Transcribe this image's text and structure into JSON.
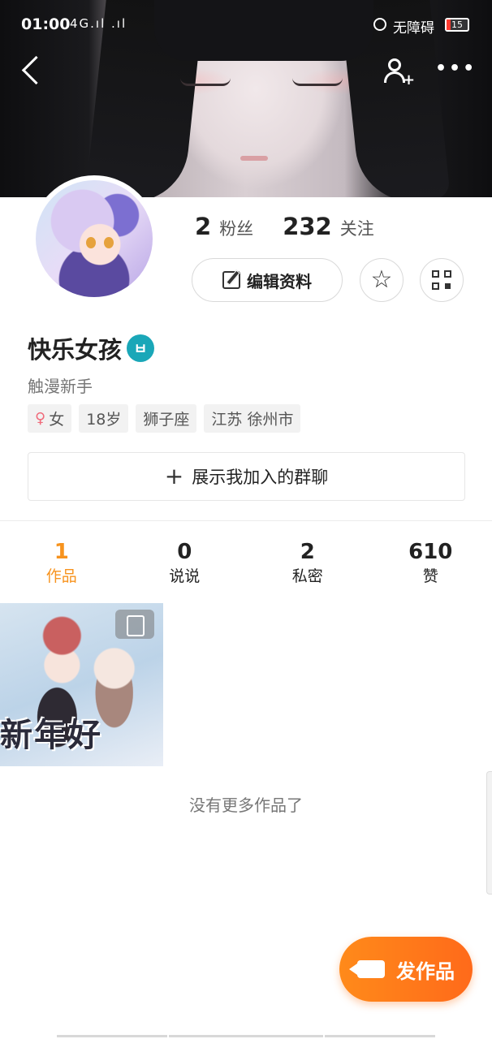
{
  "status_bar": {
    "time": "01:00",
    "signal": "4G.ıl .ıl",
    "accessibility": "无障碍",
    "battery": "15"
  },
  "profile": {
    "fans_count": "2",
    "fans_label": "粉丝",
    "following_count": "232",
    "following_label": "关注",
    "edit_label": "编辑资料",
    "nickname": "快乐女孩",
    "vip_badge": "ㅂ",
    "level": "触漫新手",
    "tags": {
      "gender": "女",
      "age": "18岁",
      "zodiac": "狮子座",
      "location": "江苏 徐州市"
    },
    "group_button": "展示我加入的群聊"
  },
  "tabs": [
    {
      "count": "1",
      "label": "作品",
      "active": true
    },
    {
      "count": "0",
      "label": "说说",
      "active": false
    },
    {
      "count": "2",
      "label": "私密",
      "active": false
    },
    {
      "count": "610",
      "label": "赞",
      "active": false
    }
  ],
  "works": {
    "items": [
      {
        "caption": "新年好"
      }
    ],
    "empty_text": "没有更多作品了"
  },
  "publish_button": "发作品",
  "colors": {
    "accent": "#f7931e",
    "publish": "#ff7a1a",
    "vip": "#1aa7b8"
  },
  "icons": [
    "back-icon",
    "add-friend-icon",
    "more-icon",
    "edit-icon",
    "star-icon",
    "qr-code-icon",
    "female-icon",
    "plus-icon",
    "image-type-icon",
    "camera-icon"
  ]
}
